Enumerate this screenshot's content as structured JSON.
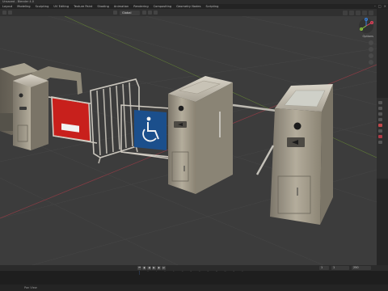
{
  "window": {
    "title": "Unsaved - Blender 4.0"
  },
  "menu": {
    "items": [
      "Layout",
      "Modeling",
      "Sculpting",
      "UV Editing",
      "Texture Paint",
      "Shading",
      "Animation",
      "Rendering",
      "Compositing",
      "Geometry Nodes",
      "Scripting"
    ]
  },
  "header": {
    "mode_label": "Global"
  },
  "viewport": {
    "options_label": "Options",
    "gizmo_axes": [
      "X",
      "Y",
      "Z"
    ]
  },
  "timeline": {
    "frame_current": "1",
    "frame_start": "1",
    "frame_end": "250",
    "ticks": [
      "0",
      "20",
      "40",
      "60",
      "80",
      "100",
      "120",
      "140",
      "160",
      "180",
      "200",
      "220",
      "240"
    ]
  },
  "status": {
    "text": "Pan View"
  },
  "colors": {
    "viewport_bg": "#3c3c3c",
    "stop_sign": "#c8201c",
    "accessibility_sign": "#1b4f8c",
    "turnstile_metal": "#9b9483",
    "axis_x": "#e0445c",
    "axis_y": "#8ac43d",
    "axis_z": "#3b82d9"
  }
}
